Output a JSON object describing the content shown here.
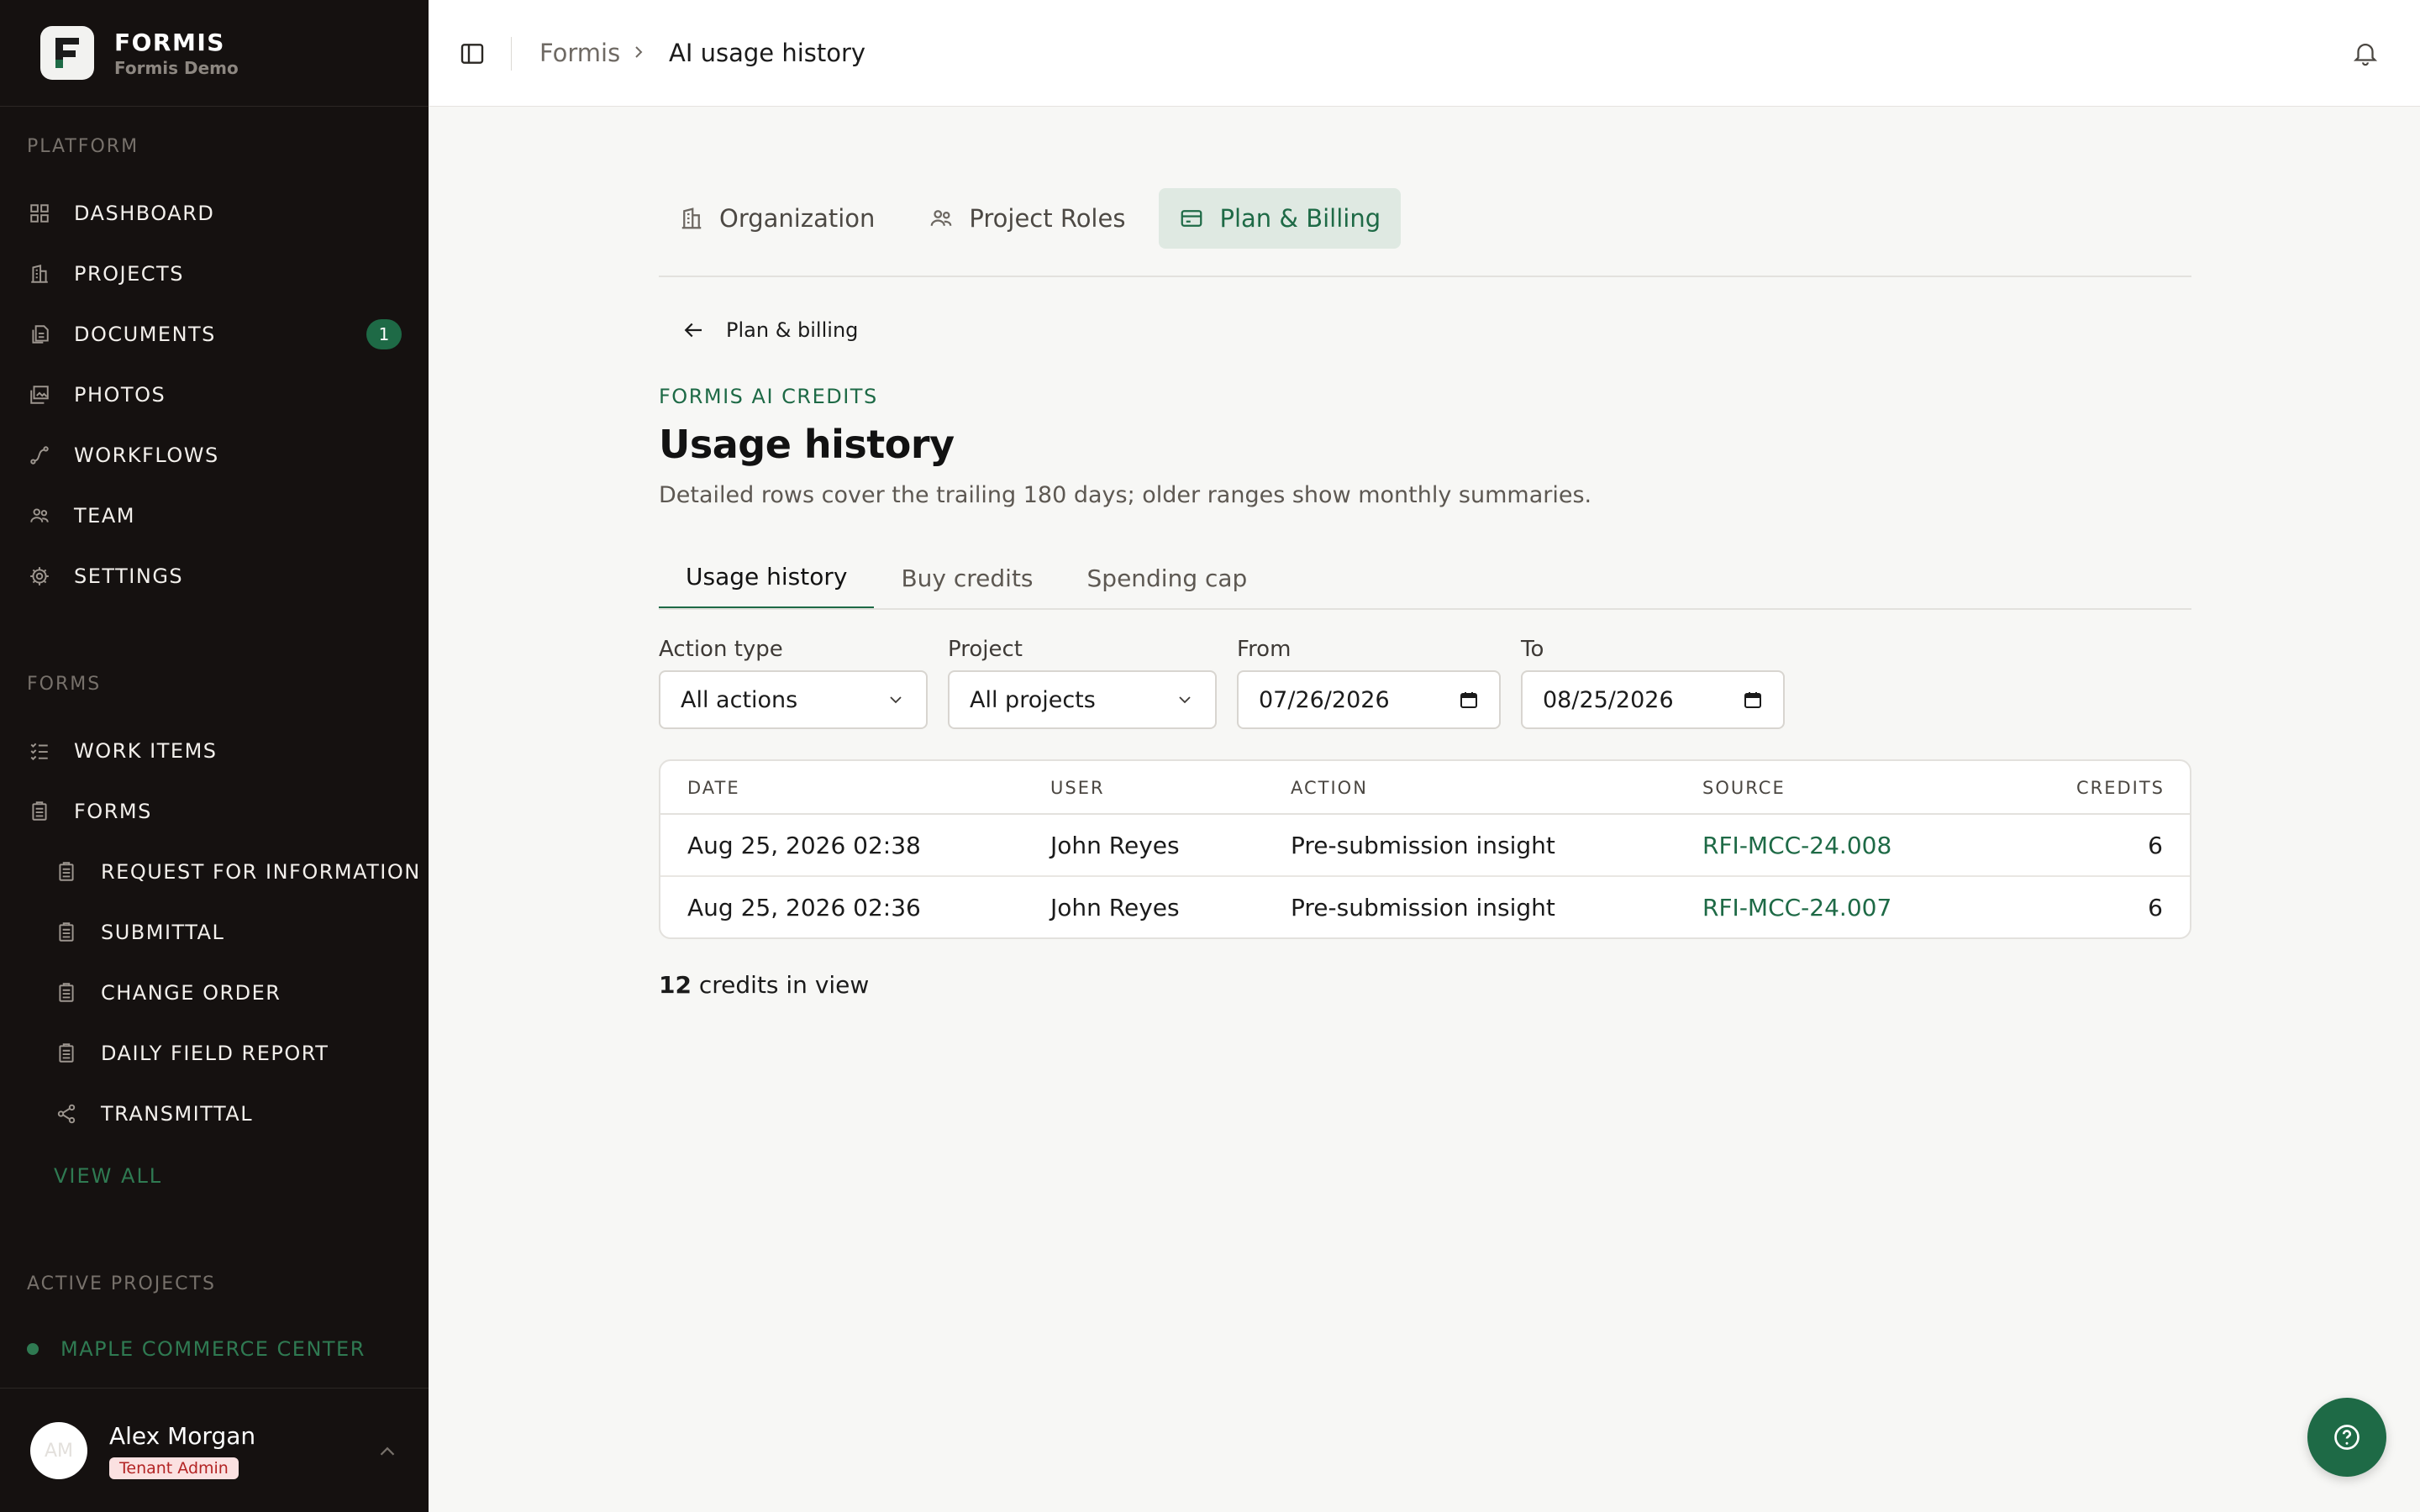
{
  "brand": {
    "name": "FORMIS",
    "subtitle": "Formis Demo"
  },
  "sidebar": {
    "platform_label": "PLATFORM",
    "platform_items": [
      {
        "label": "DASHBOARD",
        "icon": "grid-icon"
      },
      {
        "label": "PROJECTS",
        "icon": "building-icon"
      },
      {
        "label": "DOCUMENTS",
        "icon": "documents-icon",
        "badge": "1"
      },
      {
        "label": "PHOTOS",
        "icon": "photos-icon"
      },
      {
        "label": "WORKFLOWS",
        "icon": "workflow-icon"
      },
      {
        "label": "TEAM",
        "icon": "team-icon"
      },
      {
        "label": "SETTINGS",
        "icon": "gear-icon"
      }
    ],
    "forms_label": "FORMS",
    "forms_items": [
      {
        "label": "WORK ITEMS",
        "icon": "checklist-icon"
      },
      {
        "label": "FORMS",
        "icon": "clipboard-icon"
      }
    ],
    "form_types": [
      {
        "label": "REQUEST FOR INFORMATION",
        "icon": "clipboard-icon"
      },
      {
        "label": "SUBMITTAL",
        "icon": "clipboard-icon"
      },
      {
        "label": "CHANGE ORDER",
        "icon": "clipboard-icon"
      },
      {
        "label": "DAILY FIELD REPORT",
        "icon": "clipboard-icon"
      },
      {
        "label": "TRANSMITTAL",
        "icon": "share-icon"
      }
    ],
    "view_all": "VIEW ALL",
    "active_projects_label": "ACTIVE PROJECTS",
    "active_projects": [
      {
        "label": "MAPLE COMMERCE CENTER"
      }
    ]
  },
  "user": {
    "initials": "AM",
    "name": "Alex Morgan",
    "role": "Tenant Admin"
  },
  "breadcrumb": {
    "root": "Formis",
    "current": "AI usage history"
  },
  "main_tabs": [
    {
      "label": "Organization",
      "icon": "building-icon",
      "active": false
    },
    {
      "label": "Project Roles",
      "icon": "team-icon",
      "active": false
    },
    {
      "label": "Plan & Billing",
      "icon": "credit-card-icon",
      "active": true
    }
  ],
  "back_link": "Plan & billing",
  "eyebrow": "FORMIS AI CREDITS",
  "page_title": "Usage history",
  "page_description": "Detailed rows cover the trailing 180 days; older ranges show monthly summaries.",
  "sub_tabs": [
    {
      "label": "Usage history",
      "active": true
    },
    {
      "label": "Buy credits",
      "active": false
    },
    {
      "label": "Spending cap",
      "active": false
    }
  ],
  "filters": {
    "action_type": {
      "label": "Action type",
      "value": "All actions"
    },
    "project": {
      "label": "Project",
      "value": "All projects"
    },
    "from": {
      "label": "From",
      "value": "07/26/2026"
    },
    "to": {
      "label": "To",
      "value": "08/25/2026"
    }
  },
  "table": {
    "columns": [
      "DATE",
      "USER",
      "ACTION",
      "SOURCE",
      "CREDITS"
    ],
    "rows": [
      {
        "date": "Aug 25, 2026 02:38",
        "user": "John Reyes",
        "action": "Pre-submission insight",
        "source": "RFI-MCC-24.008",
        "credits": "6"
      },
      {
        "date": "Aug 25, 2026 02:36",
        "user": "John Reyes",
        "action": "Pre-submission insight",
        "source": "RFI-MCC-24.007",
        "credits": "6"
      }
    ]
  },
  "summary": {
    "count": "12",
    "text": " credits in view"
  },
  "colors": {
    "accent": "#1e6a46",
    "sidebar_bg": "#151110",
    "page_bg": "#f7f7f5"
  }
}
